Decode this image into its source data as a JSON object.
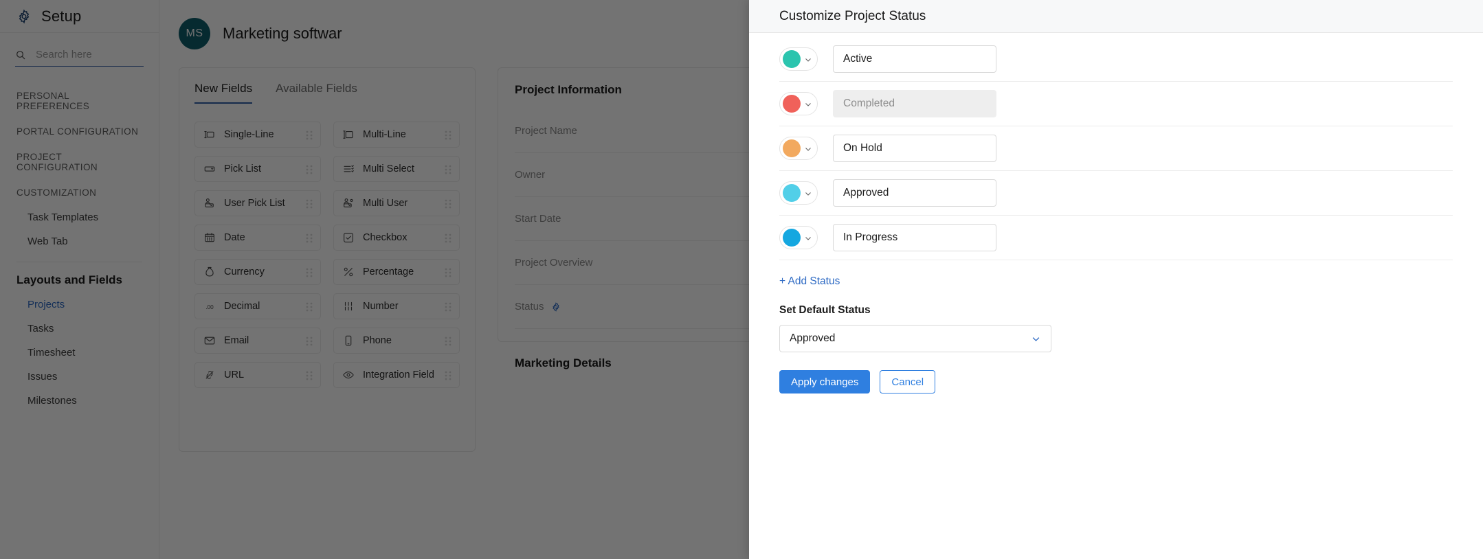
{
  "sidebar": {
    "app_title": "Setup",
    "gear_icon": "gear-icon",
    "search": {
      "placeholder": "Search here",
      "value": "",
      "icon": "search-icon"
    },
    "sections": [
      {
        "label": "PERSONAL PREFERENCES"
      },
      {
        "label": "PORTAL CONFIGURATION"
      },
      {
        "label": "PROJECT CONFIGURATION"
      },
      {
        "label": "CUSTOMIZATION"
      }
    ],
    "customization_items": [
      {
        "label": "Task Templates"
      },
      {
        "label": "Web Tab"
      }
    ],
    "group_title": "Layouts and Fields",
    "layout_items": [
      {
        "label": "Projects",
        "active": true
      },
      {
        "label": "Tasks",
        "active": false
      },
      {
        "label": "Timesheet",
        "active": false
      },
      {
        "label": "Issues",
        "active": false
      },
      {
        "label": "Milestones",
        "active": false
      }
    ]
  },
  "main": {
    "project": {
      "initials": "MS",
      "name": "Marketing softwar"
    },
    "tabs": [
      {
        "label": "New Fields",
        "active": true
      },
      {
        "label": "Available Fields",
        "active": false
      }
    ],
    "fields": [
      {
        "label": "Single-Line",
        "icon": "single-line-text-icon"
      },
      {
        "label": "Multi-Line",
        "icon": "multi-line-text-icon"
      },
      {
        "label": "Pick List",
        "icon": "dropdown-icon"
      },
      {
        "label": "Multi Select",
        "icon": "multi-select-icon"
      },
      {
        "label": "User Pick List",
        "icon": "user-dropdown-icon"
      },
      {
        "label": "Multi User",
        "icon": "multi-user-icon"
      },
      {
        "label": "Date",
        "icon": "calendar-icon"
      },
      {
        "label": "Checkbox",
        "icon": "checkbox-icon"
      },
      {
        "label": "Currency",
        "icon": "money-bag-icon"
      },
      {
        "label": "Percentage",
        "icon": "percent-icon"
      },
      {
        "label": "Decimal",
        "icon": "decimal-icon"
      },
      {
        "label": "Number",
        "icon": "number-icon"
      },
      {
        "label": "Email",
        "icon": "email-icon"
      },
      {
        "label": "Phone",
        "icon": "phone-icon"
      },
      {
        "label": "URL",
        "icon": "link-icon"
      },
      {
        "label": "Integration Field",
        "icon": "integration-icon"
      }
    ],
    "info_panel": {
      "title": "Project Information",
      "rows": [
        {
          "label": "Project Name",
          "has_gear": false
        },
        {
          "label": "Owner",
          "has_gear": false
        },
        {
          "label": "Start Date",
          "has_gear": false
        },
        {
          "label": "Project Overview",
          "has_gear": false
        },
        {
          "label": "Status",
          "has_gear": true
        }
      ],
      "second_title": "Marketing Details"
    }
  },
  "drawer": {
    "title": "Customize Project Status",
    "statuses": [
      {
        "name": "Active",
        "color": "#2bc4ae",
        "disabled": false
      },
      {
        "name": "Completed",
        "color": "#f0615a",
        "disabled": true
      },
      {
        "name": "On Hold",
        "color": "#f2a95f",
        "disabled": false
      },
      {
        "name": "Approved",
        "color": "#52cfe8",
        "disabled": false
      },
      {
        "name": "In Progress",
        "color": "#14a7e0",
        "disabled": false
      }
    ],
    "add_status_label": "+ Add Status",
    "default_label": "Set Default Status",
    "default_value": "Approved",
    "apply_label": "Apply changes",
    "cancel_label": "Cancel"
  }
}
